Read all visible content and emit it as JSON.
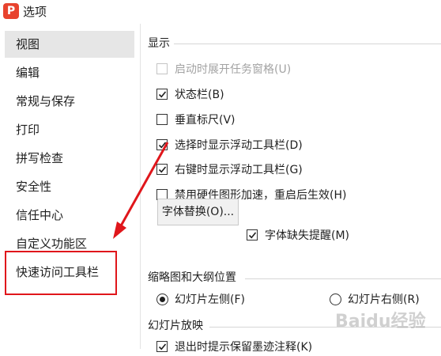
{
  "window": {
    "title": "选项",
    "logo_letter": "P",
    "brand_color": "#e8432e"
  },
  "sidebar": {
    "items": [
      {
        "label": "视图",
        "selected": true
      },
      {
        "label": "编辑"
      },
      {
        "label": "常规与保存"
      },
      {
        "label": "打印"
      },
      {
        "label": "拼写检查"
      },
      {
        "label": "安全性"
      },
      {
        "label": "信任中心"
      },
      {
        "label": "自定义功能区"
      },
      {
        "label": "快速访问工具栏",
        "highlighted": true
      }
    ]
  },
  "display": {
    "heading": "显示",
    "options": [
      {
        "label": "启动时展开任务窗格(U)",
        "checked": false,
        "disabled": true
      },
      {
        "label": "状态栏(B)",
        "checked": true
      },
      {
        "label": "垂直标尺(V)",
        "checked": false
      },
      {
        "label": "选择时显示浮动工具栏(D)",
        "checked": true
      },
      {
        "label": "右键时显示浮动工具栏(G)",
        "checked": true
      },
      {
        "label": "禁用硬件图形加速，重启后生效(H)",
        "checked": false
      }
    ],
    "font_replace_button": "字体替换(O)...",
    "font_missing_label": "字体缺失提醒(M)",
    "font_missing_checked": true
  },
  "thumbnail": {
    "heading": "缩略图和大纲位置",
    "options": [
      {
        "label": "幻灯片左侧(F)",
        "selected": true
      },
      {
        "label": "幻灯片右侧(R)",
        "selected": false
      }
    ]
  },
  "slideshow": {
    "heading": "幻灯片放映",
    "partial_label": "退出时提示保留墨迹注释(K)"
  },
  "annotation": {
    "color": "#e0161b"
  },
  "watermark": "Baidu经验"
}
